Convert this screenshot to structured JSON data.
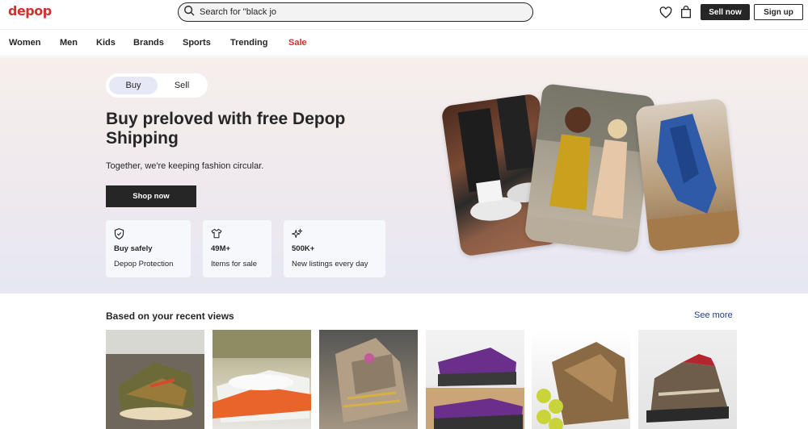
{
  "header": {
    "logo": "depop",
    "search_value": "Search for \"black jo",
    "sell_now": "Sell now",
    "sign_up": "Sign up"
  },
  "nav": [
    "Women",
    "Men",
    "Kids",
    "Brands",
    "Sports",
    "Trending",
    "Sale"
  ],
  "hero": {
    "toggle": {
      "buy": "Buy",
      "sell": "Sell"
    },
    "title": "Buy preloved with free Depop Shipping",
    "subtitle": "Together, we're keeping fashion circular.",
    "cta": "Shop now",
    "cards": [
      {
        "icon": "shield-icon",
        "title": "Buy safely",
        "desc": "Depop Protection"
      },
      {
        "icon": "tshirt-icon",
        "title": "49M+",
        "desc": "Items for sale"
      },
      {
        "icon": "sparkle-icon",
        "title": "500K+",
        "desc": "New listings every day"
      }
    ]
  },
  "recent": {
    "title": "Based on your recent views",
    "see_more": "See more"
  },
  "colors": {
    "brand_red": "#d3302f",
    "dark": "#262626",
    "link_blue": "#1f3e8c"
  }
}
